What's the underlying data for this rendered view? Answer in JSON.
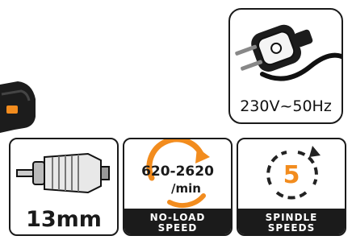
{
  "power": {
    "voltage_label": "230V~50Hz",
    "icon": "power-plug-icon"
  },
  "features": {
    "chuck": {
      "label": "13mm",
      "icon": "drill-chuck-icon"
    },
    "speed": {
      "range": "620-2620",
      "unit": "/min",
      "line1": "NO-LOAD",
      "line2": "SPEED",
      "icon": "rotation-arrow-icon"
    },
    "spindle": {
      "count": "5",
      "line1": "SPINDLE",
      "line2": "SPEEDS",
      "icon": "circular-arrows-icon"
    }
  },
  "colors": {
    "accent": "#f28c1e",
    "dark": "#1b1b1b",
    "border": "#1a1a1a"
  }
}
